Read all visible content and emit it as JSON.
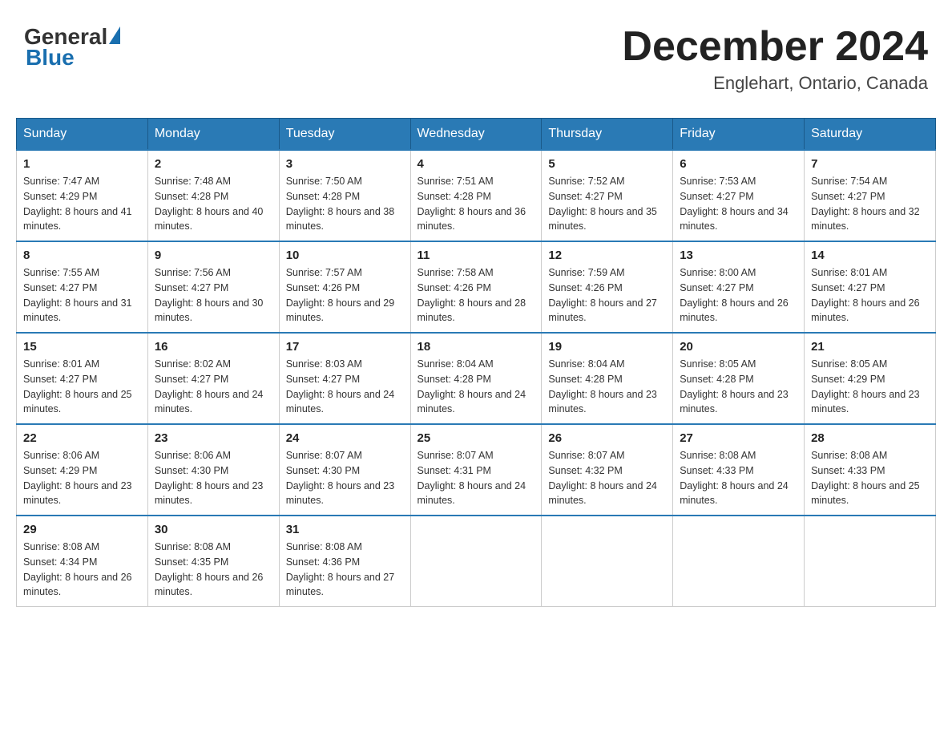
{
  "header": {
    "logo_general": "General",
    "logo_blue": "Blue",
    "month_title": "December 2024",
    "location": "Englehart, Ontario, Canada"
  },
  "weekdays": [
    "Sunday",
    "Monday",
    "Tuesday",
    "Wednesday",
    "Thursday",
    "Friday",
    "Saturday"
  ],
  "weeks": [
    [
      {
        "day": "1",
        "sunrise": "7:47 AM",
        "sunset": "4:29 PM",
        "daylight": "8 hours and 41 minutes."
      },
      {
        "day": "2",
        "sunrise": "7:48 AM",
        "sunset": "4:28 PM",
        "daylight": "8 hours and 40 minutes."
      },
      {
        "day": "3",
        "sunrise": "7:50 AM",
        "sunset": "4:28 PM",
        "daylight": "8 hours and 38 minutes."
      },
      {
        "day": "4",
        "sunrise": "7:51 AM",
        "sunset": "4:28 PM",
        "daylight": "8 hours and 36 minutes."
      },
      {
        "day": "5",
        "sunrise": "7:52 AM",
        "sunset": "4:27 PM",
        "daylight": "8 hours and 35 minutes."
      },
      {
        "day": "6",
        "sunrise": "7:53 AM",
        "sunset": "4:27 PM",
        "daylight": "8 hours and 34 minutes."
      },
      {
        "day": "7",
        "sunrise": "7:54 AM",
        "sunset": "4:27 PM",
        "daylight": "8 hours and 32 minutes."
      }
    ],
    [
      {
        "day": "8",
        "sunrise": "7:55 AM",
        "sunset": "4:27 PM",
        "daylight": "8 hours and 31 minutes."
      },
      {
        "day": "9",
        "sunrise": "7:56 AM",
        "sunset": "4:27 PM",
        "daylight": "8 hours and 30 minutes."
      },
      {
        "day": "10",
        "sunrise": "7:57 AM",
        "sunset": "4:26 PM",
        "daylight": "8 hours and 29 minutes."
      },
      {
        "day": "11",
        "sunrise": "7:58 AM",
        "sunset": "4:26 PM",
        "daylight": "8 hours and 28 minutes."
      },
      {
        "day": "12",
        "sunrise": "7:59 AM",
        "sunset": "4:26 PM",
        "daylight": "8 hours and 27 minutes."
      },
      {
        "day": "13",
        "sunrise": "8:00 AM",
        "sunset": "4:27 PM",
        "daylight": "8 hours and 26 minutes."
      },
      {
        "day": "14",
        "sunrise": "8:01 AM",
        "sunset": "4:27 PM",
        "daylight": "8 hours and 26 minutes."
      }
    ],
    [
      {
        "day": "15",
        "sunrise": "8:01 AM",
        "sunset": "4:27 PM",
        "daylight": "8 hours and 25 minutes."
      },
      {
        "day": "16",
        "sunrise": "8:02 AM",
        "sunset": "4:27 PM",
        "daylight": "8 hours and 24 minutes."
      },
      {
        "day": "17",
        "sunrise": "8:03 AM",
        "sunset": "4:27 PM",
        "daylight": "8 hours and 24 minutes."
      },
      {
        "day": "18",
        "sunrise": "8:04 AM",
        "sunset": "4:28 PM",
        "daylight": "8 hours and 24 minutes."
      },
      {
        "day": "19",
        "sunrise": "8:04 AM",
        "sunset": "4:28 PM",
        "daylight": "8 hours and 23 minutes."
      },
      {
        "day": "20",
        "sunrise": "8:05 AM",
        "sunset": "4:28 PM",
        "daylight": "8 hours and 23 minutes."
      },
      {
        "day": "21",
        "sunrise": "8:05 AM",
        "sunset": "4:29 PM",
        "daylight": "8 hours and 23 minutes."
      }
    ],
    [
      {
        "day": "22",
        "sunrise": "8:06 AM",
        "sunset": "4:29 PM",
        "daylight": "8 hours and 23 minutes."
      },
      {
        "day": "23",
        "sunrise": "8:06 AM",
        "sunset": "4:30 PM",
        "daylight": "8 hours and 23 minutes."
      },
      {
        "day": "24",
        "sunrise": "8:07 AM",
        "sunset": "4:30 PM",
        "daylight": "8 hours and 23 minutes."
      },
      {
        "day": "25",
        "sunrise": "8:07 AM",
        "sunset": "4:31 PM",
        "daylight": "8 hours and 24 minutes."
      },
      {
        "day": "26",
        "sunrise": "8:07 AM",
        "sunset": "4:32 PM",
        "daylight": "8 hours and 24 minutes."
      },
      {
        "day": "27",
        "sunrise": "8:08 AM",
        "sunset": "4:33 PM",
        "daylight": "8 hours and 24 minutes."
      },
      {
        "day": "28",
        "sunrise": "8:08 AM",
        "sunset": "4:33 PM",
        "daylight": "8 hours and 25 minutes."
      }
    ],
    [
      {
        "day": "29",
        "sunrise": "8:08 AM",
        "sunset": "4:34 PM",
        "daylight": "8 hours and 26 minutes."
      },
      {
        "day": "30",
        "sunrise": "8:08 AM",
        "sunset": "4:35 PM",
        "daylight": "8 hours and 26 minutes."
      },
      {
        "day": "31",
        "sunrise": "8:08 AM",
        "sunset": "4:36 PM",
        "daylight": "8 hours and 27 minutes."
      },
      null,
      null,
      null,
      null
    ]
  ]
}
